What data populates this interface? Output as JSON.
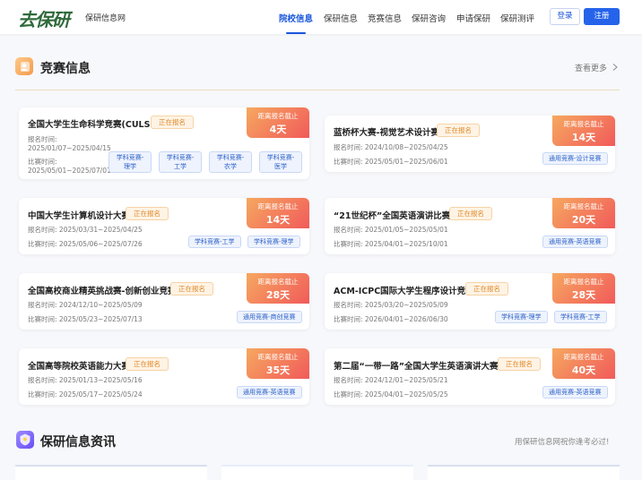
{
  "header": {
    "logo": "去保研",
    "site_name": "保研信息网",
    "nav": [
      "院校信息",
      "保研信息",
      "竞赛信息",
      "保研咨询",
      "申请保研",
      "保研测评"
    ],
    "active_nav": 0,
    "login_label": "登录",
    "register_label": "注册"
  },
  "competitions": {
    "title": "竞赛信息",
    "more_label": "查看更多",
    "cards": [
      {
        "title": "全国大学生生命科学竞赛(CULSC)",
        "status": "正在报名",
        "reg_label": "报名时间:",
        "reg_time": "2025/01/07~2025/04/15",
        "comp_label": "比赛时间:",
        "comp_time": "2025/05/01~2025/07/01",
        "cd_label": "距离报名截止",
        "cd_days": "4天",
        "tags": [
          "学科竞赛-理学",
          "学科竞赛-工学",
          "学科竞赛-农学",
          "学科竞赛-医学"
        ]
      },
      {
        "title": "蓝桥杯大赛-视觉艺术设计赛",
        "status": "正在报名",
        "reg_label": "报名时间:",
        "reg_time": "2024/10/08~2025/04/25",
        "comp_label": "比赛时间:",
        "comp_time": "2025/05/01~2025/06/01",
        "cd_label": "距离报名截止",
        "cd_days": "14天",
        "tags": [
          "通用竞赛-设计竞赛"
        ]
      },
      {
        "title": "中国大学生计算机设计大赛",
        "status": "正在报名",
        "reg_label": "报名时间:",
        "reg_time": "2025/03/31~2025/04/25",
        "comp_label": "比赛时间:",
        "comp_time": "2025/05/06~2025/07/26",
        "cd_label": "距离报名截止",
        "cd_days": "14天",
        "tags": [
          "学科竞赛-工学",
          "学科竞赛-理学"
        ]
      },
      {
        "title": "“21世纪杯”全国英语演讲比赛",
        "status": "正在报名",
        "reg_label": "报名时间:",
        "reg_time": "2025/01/05~2025/05/01",
        "comp_label": "比赛时间:",
        "comp_time": "2025/04/01~2025/10/01",
        "cd_label": "距离报名截止",
        "cd_days": "20天",
        "tags": [
          "通用竞赛-英语竞赛"
        ]
      },
      {
        "title": "全国高校商业精英挑战赛-创新创业竞赛",
        "status": "正在报名",
        "reg_label": "报名时间:",
        "reg_time": "2024/12/10~2025/05/09",
        "comp_label": "比赛时间:",
        "comp_time": "2025/05/23~2025/07/13",
        "cd_label": "距离报名截止",
        "cd_days": "28天",
        "tags": [
          "通用竞赛-商创竞赛"
        ]
      },
      {
        "title": "ACM-ICPC国际大学生程序设计竞赛",
        "status": "正在报名",
        "reg_label": "报名时间:",
        "reg_time": "2025/03/20~2025/05/09",
        "comp_label": "比赛时间:",
        "comp_time": "2026/04/01~2026/06/30",
        "cd_label": "距离报名截止",
        "cd_days": "28天",
        "tags": [
          "学科竞赛-理学",
          "学科竞赛-工学"
        ]
      },
      {
        "title": "全国高等院校英语能力大赛",
        "status": "正在报名",
        "reg_label": "报名时间:",
        "reg_time": "2025/01/13~2025/05/16",
        "comp_label": "比赛时间:",
        "comp_time": "2025/05/17~2025/05/24",
        "cd_label": "距离报名截止",
        "cd_days": "35天",
        "tags": [
          "通用竞赛-英语竞赛"
        ]
      },
      {
        "title": "第二届“一带一路”全国大学生英语演讲大赛",
        "status": "正在报名",
        "reg_label": "报名时间:",
        "reg_time": "2024/12/01~2025/05/21",
        "comp_label": "比赛时间:",
        "comp_time": "2025/04/01~2025/05/25",
        "cd_label": "距离报名截止",
        "cd_days": "40天",
        "tags": [
          "通用竞赛-英语竞赛"
        ]
      }
    ]
  },
  "news": {
    "title": "保研信息资讯",
    "note": "用保研信息网祝你逢考必过!"
  },
  "colors": {
    "accent": "#1a56db",
    "register_bg": "#2563eb",
    "badge_text": "#e08a2b",
    "countdown_start": "#f6a860",
    "countdown_end": "#f15a5a",
    "tag_text": "#2a5fc8"
  },
  "icons": {
    "competition_section": "trophy-user-icon",
    "news_section": "shield-badge-icon",
    "more": "chevron-right-icon"
  }
}
